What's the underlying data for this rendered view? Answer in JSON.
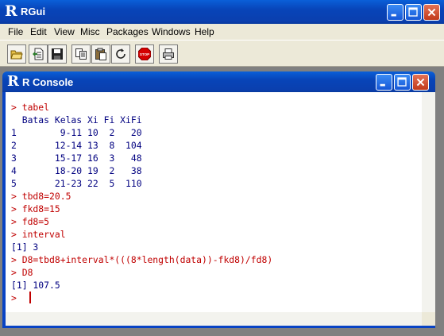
{
  "app": {
    "title": "RGui",
    "logo": "R"
  },
  "menu": [
    "File",
    "Edit",
    "View",
    "Misc",
    "Packages",
    "Windows",
    "Help"
  ],
  "toolbar": {
    "buttons": [
      "open-script-icon",
      "load-workspace-icon",
      "save-icon",
      "copy-icon",
      "paste-icon",
      "refresh-icon",
      "stop-icon",
      "print-icon"
    ],
    "stop_label": "STOP"
  },
  "console_window": {
    "title": "R Console",
    "logo": "R"
  },
  "console": {
    "lines": [
      {
        "text": "> tabel",
        "kind": "cmd"
      },
      {
        "text": "  Batas Kelas Xi Fi XiFi",
        "kind": "out"
      },
      {
        "text": "1        9-11 10  2   20",
        "kind": "out"
      },
      {
        "text": "2       12-14 13  8  104",
        "kind": "out"
      },
      {
        "text": "3       15-17 16  3   48",
        "kind": "out"
      },
      {
        "text": "4       18-20 19  2   38",
        "kind": "out"
      },
      {
        "text": "5       21-23 22  5  110",
        "kind": "out"
      },
      {
        "text": "> tbd8=20.5",
        "kind": "cmd"
      },
      {
        "text": "> fkd8=15",
        "kind": "cmd"
      },
      {
        "text": "> fd8=5",
        "kind": "cmd"
      },
      {
        "text": "> interval",
        "kind": "cmd"
      },
      {
        "text": "[1] 3",
        "kind": "out"
      },
      {
        "text": "> D8=tbd8+interval*(((8*length(data))-fkd8)/fd8)",
        "kind": "cmd"
      },
      {
        "text": "> D8",
        "kind": "cmd"
      },
      {
        "text": "[1] 107.5",
        "kind": "out"
      },
      {
        "text": "> ",
        "kind": "cmd"
      }
    ]
  },
  "colors": {
    "command": "#c00000",
    "output": "#000080",
    "titlebar": "#0a3fae"
  }
}
